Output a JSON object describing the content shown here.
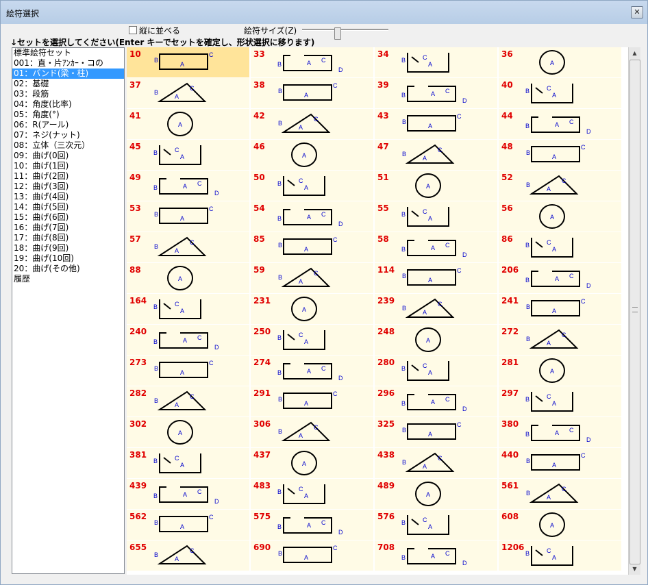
{
  "window": {
    "title": "絵符選択",
    "close_label": "✕"
  },
  "toolbar": {
    "vertical_label": "縦に並べる",
    "vertical_checked": false,
    "size_label": "絵符サイズ(Z)",
    "size_value": 0.4
  },
  "instruction": "↓セットを選択してください(Enter キーでセットを確定し、形状選択に移ります)",
  "sets": [
    "標準絵符セット",
    "001：直・片ｱﾝｶｰ・コの",
    "01：バンド(梁・柱)",
    "02：基礎",
    "03：段筋",
    "04：角度(比率)",
    "05：角度(°)",
    "06：R(アール)",
    "07：ネジ(ナット)",
    "08：立体（三次元）",
    "09：曲げ(0回)",
    "10：曲げ(1回)",
    "11：曲げ(2回)",
    "12：曲げ(3回)",
    "13：曲げ(4回)",
    "14：曲げ(5回)",
    "15：曲げ(6回)",
    "16：曲げ(7回)",
    "17：曲げ(8回)",
    "18：曲げ(9回)",
    "19：曲げ(10回)",
    "20：曲げ(その他)",
    "履歴"
  ],
  "selected_set_index": 2,
  "selected_shape": "10",
  "shapes": [
    [
      "10",
      "33",
      "34",
      "36"
    ],
    [
      "37",
      "38",
      "39",
      "40"
    ],
    [
      "41",
      "42",
      "43",
      "44"
    ],
    [
      "45",
      "46",
      "47",
      "48"
    ],
    [
      "49",
      "50",
      "51",
      "52"
    ],
    [
      "53",
      "54",
      "55",
      "56"
    ],
    [
      "57",
      "85",
      "58",
      "86"
    ],
    [
      "88",
      "59",
      "114",
      "206"
    ],
    [
      "164",
      "231",
      "239",
      "241"
    ],
    [
      "240",
      "250",
      "248",
      "272"
    ],
    [
      "273",
      "274",
      "280",
      "281"
    ],
    [
      "282",
      "291",
      "296",
      "297"
    ],
    [
      "302",
      "306",
      "325",
      "380"
    ],
    [
      "381",
      "437",
      "438",
      "440"
    ],
    [
      "439",
      "483",
      "489",
      "561"
    ],
    [
      "562",
      "575",
      "576",
      "608"
    ],
    [
      "655",
      "690",
      "708",
      "1206"
    ]
  ],
  "colors": {
    "title_bg": "#bfd3ea",
    "cell_bg": "#fffbe6",
    "cell_selected": "#ffe49a",
    "list_selected": "#3399ff",
    "shape_number": "#e00000",
    "dim_letter": "#0000cc"
  }
}
